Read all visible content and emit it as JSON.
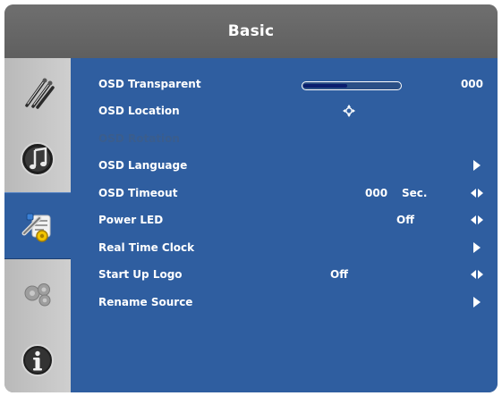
{
  "header": {
    "title": "Basic"
  },
  "sidebar": {
    "items": [
      {
        "name": "picture",
        "icon": "brush-pens-icon",
        "active": false
      },
      {
        "name": "audio",
        "icon": "music-note-icon",
        "active": false
      },
      {
        "name": "basic",
        "icon": "tools-settings-icon",
        "active": true
      },
      {
        "name": "advanced",
        "icon": "gears-icon",
        "active": false
      },
      {
        "name": "info",
        "icon": "info-icon",
        "active": false
      }
    ]
  },
  "rows": [
    {
      "label": "OSD Transparent",
      "value": "000",
      "slider_level": 0.45
    },
    {
      "label": "OSD Location"
    },
    {
      "label": "OSD Rotation",
      "disabled": true
    },
    {
      "label": "OSD Language"
    },
    {
      "label": "OSD Timeout",
      "value": "000",
      "unit": "Sec."
    },
    {
      "label": "Power LED",
      "value": "Off"
    },
    {
      "label": "Real Time Clock"
    },
    {
      "label": "Start Up Logo",
      "value": "Off"
    },
    {
      "label": "Rename Source"
    }
  ],
  "colors": {
    "content_bg": "#2f5ea0",
    "header_bg": "#666666",
    "sidebar_bg": "#c4c4c4",
    "disabled_text": "#3a5d8d",
    "slider_fill": "#0a1d6e"
  }
}
